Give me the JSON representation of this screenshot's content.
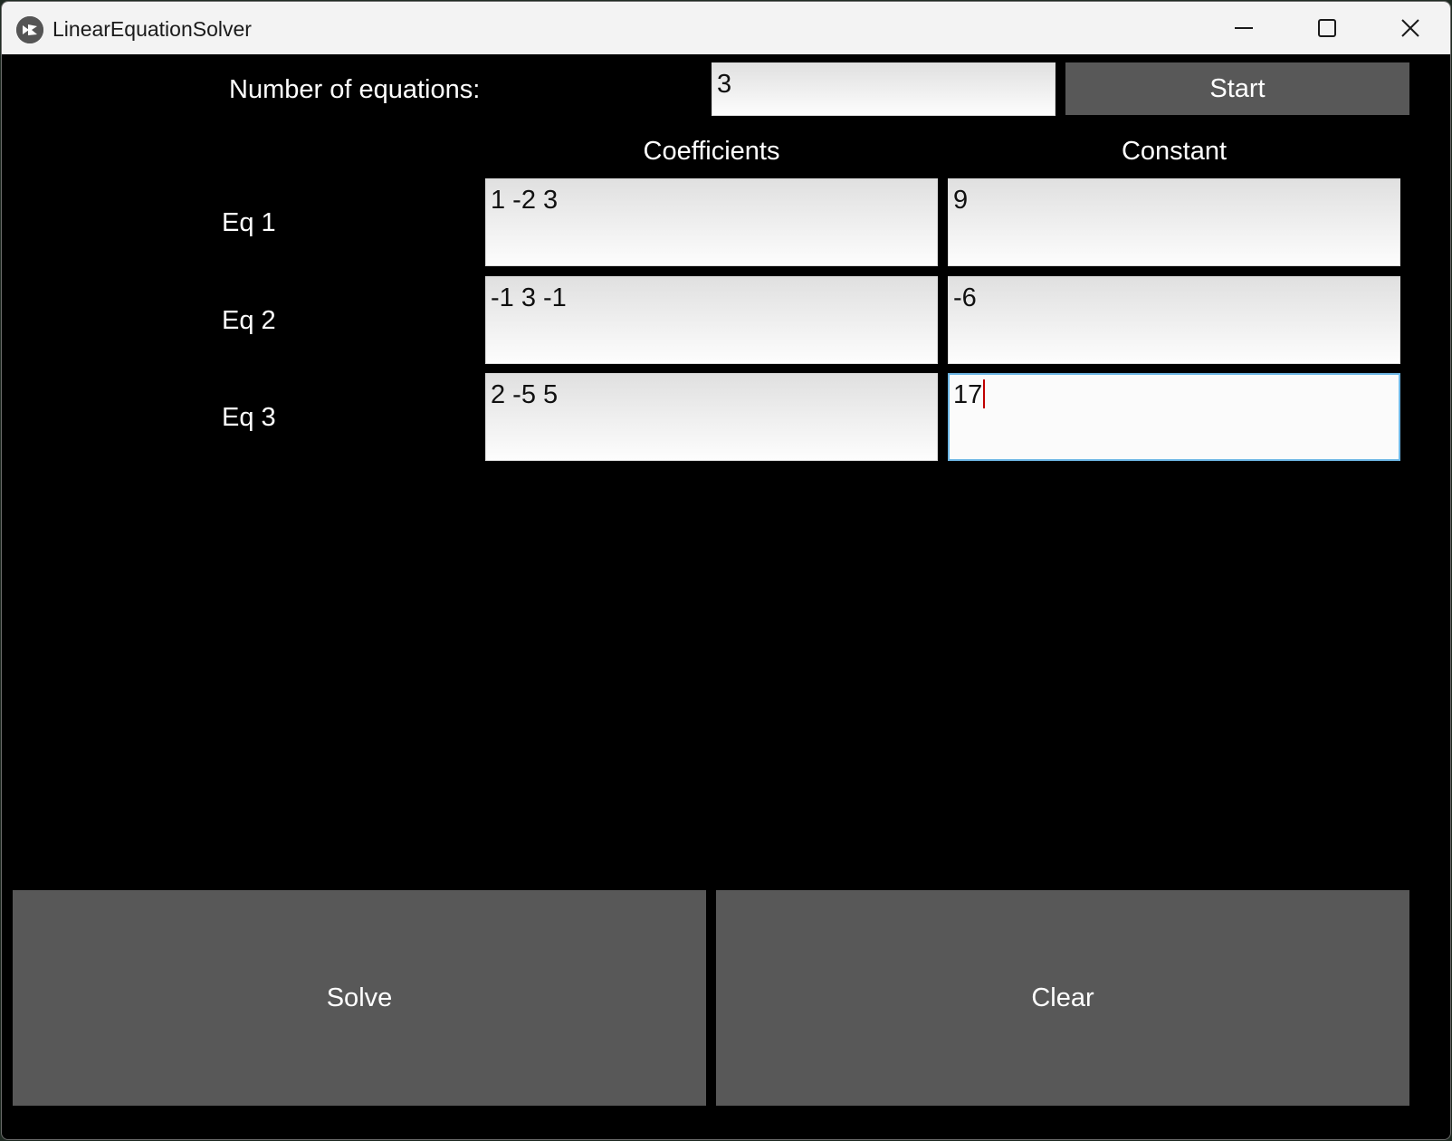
{
  "window": {
    "title": "LinearEquationSolver",
    "icon": "kivy-app-icon",
    "controls": [
      "minimize-icon",
      "maximize-icon",
      "close-icon"
    ]
  },
  "header": {
    "num_equations_label": "Number of equations:",
    "num_equations_value": "3",
    "start_label": "Start"
  },
  "columns": {
    "coefficients": "Coefficients",
    "constant": "Constant"
  },
  "equations": [
    {
      "label": "Eq 1",
      "coefficients": "1 -2 3",
      "constant": "9"
    },
    {
      "label": "Eq 2",
      "coefficients": "-1 3 -1",
      "constant": "-6"
    },
    {
      "label": "Eq 3",
      "coefficients": "2 -5 5",
      "constant": "17"
    }
  ],
  "actions": {
    "solve_label": "Solve",
    "clear_label": "Clear"
  },
  "colors": {
    "background": "#000000",
    "button": "#585858",
    "focus_border": "#6fb8e6",
    "caret": "#c00000"
  }
}
